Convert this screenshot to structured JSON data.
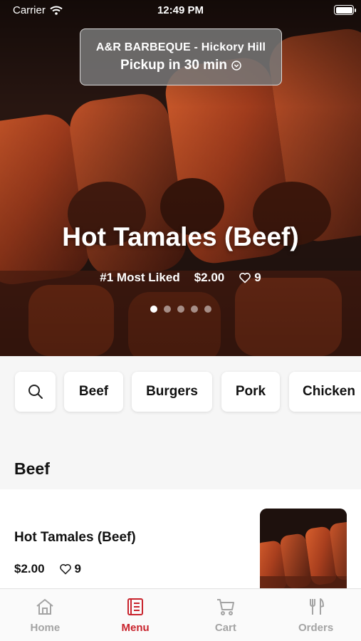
{
  "status_bar": {
    "carrier": "Carrier",
    "time": "12:49 PM"
  },
  "store": {
    "name": "A&R BARBEQUE - Hickory Hill",
    "pickup": "Pickup in 30 min"
  },
  "hero": {
    "title": "Hot Tamales (Beef)",
    "badge": "#1 Most Liked",
    "price": "$2.00",
    "likes": "9",
    "slides": 5,
    "active_slide": 0
  },
  "categories": [
    "Beef",
    "Burgers",
    "Pork",
    "Chicken"
  ],
  "section": {
    "title": "Beef"
  },
  "menu_item": {
    "name": "Hot Tamales (Beef)",
    "price": "$2.00",
    "likes": "9"
  },
  "tabs": [
    {
      "label": "Home",
      "icon": "home-icon"
    },
    {
      "label": "Menu",
      "icon": "menu-icon",
      "active": true
    },
    {
      "label": "Cart",
      "icon": "cart-icon"
    },
    {
      "label": "Orders",
      "icon": "orders-icon"
    }
  ],
  "colors": {
    "accent": "#c8232c",
    "tab_inactive": "#a4a4a4"
  }
}
